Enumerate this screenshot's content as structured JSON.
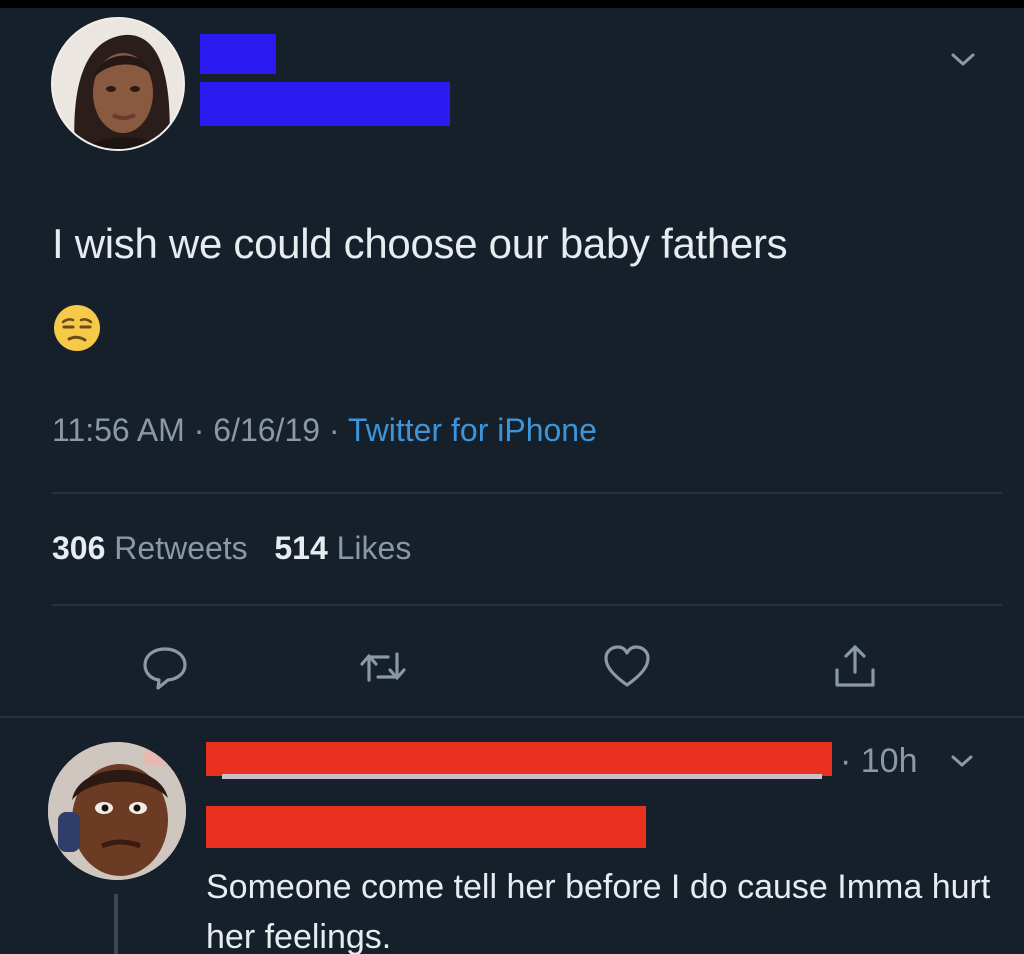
{
  "tweet": {
    "text": "I wish we could choose our baby fathers",
    "emoji": "unamused-face",
    "time": "11:56 AM",
    "date": "6/16/19",
    "separator": "·",
    "source": "Twitter for iPhone",
    "retweet_count": "306",
    "retweet_label": "Retweets",
    "like_count": "514",
    "like_label": "Likes"
  },
  "actions": {
    "icons": [
      "reply-icon",
      "retweet-icon",
      "like-icon",
      "share-icon"
    ]
  },
  "reply": {
    "time": "· 10h",
    "text": "Someone come tell her before I do cause Imma hurt her feelings."
  },
  "colors": {
    "background": "#15202b",
    "text": "#e7ecf0",
    "secondary": "#8b98a5",
    "link": "#3d94d8",
    "redact_blue": "#2b1af2",
    "redact_red": "#e8321f"
  }
}
